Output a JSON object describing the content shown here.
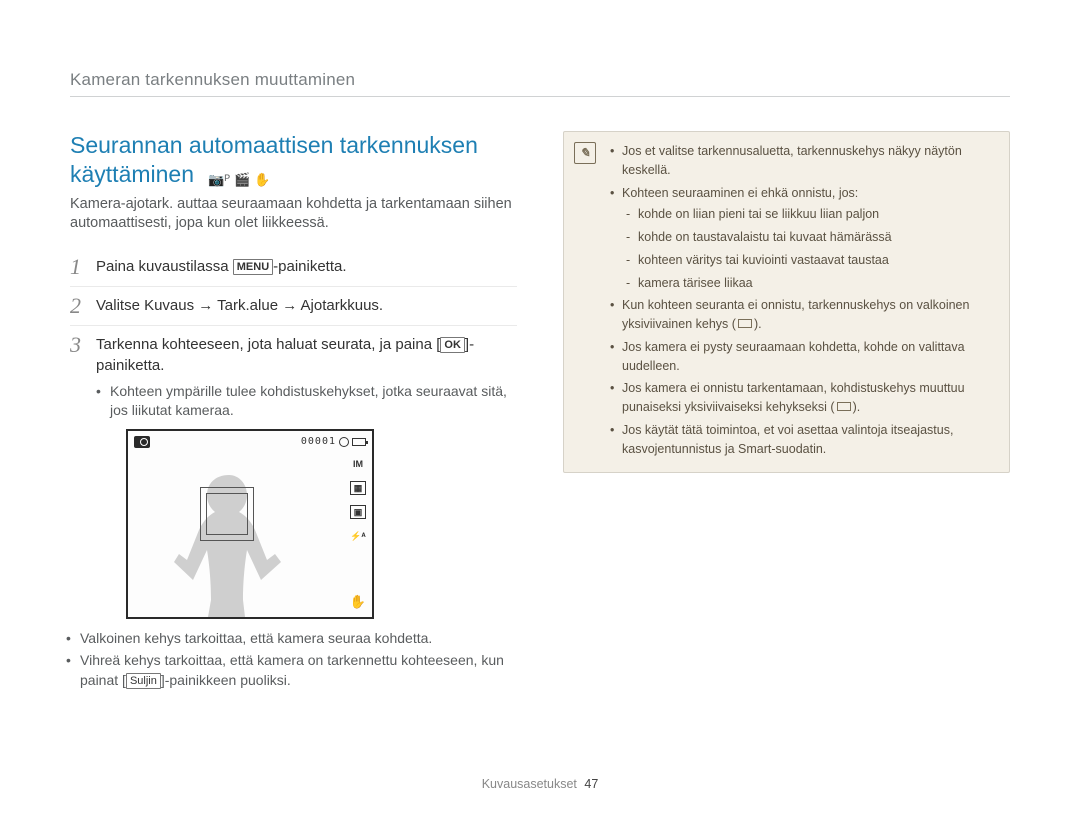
{
  "header": {
    "breadcrumb": "Kameran tarkennuksen muuttaminen"
  },
  "section": {
    "title_line1": "Seurannan automaattisen tarkennuksen",
    "title_line2": "käyttäminen",
    "mode_icons": [
      "📷ᴾ",
      "🎬",
      "✋"
    ],
    "intro": "Kamera-ajotark. auttaa seuraamaan kohdetta ja tarkentamaan siihen automaattisesti, jopa kun olet liikkeessä."
  },
  "steps": [
    {
      "num": "1",
      "pre": "Paina kuvaustilassa ",
      "button": "MENU",
      "post": "-painiketta."
    },
    {
      "num": "2",
      "pre": "Valitse ",
      "path": "Kuvaus → Tark.alue → Ajotarkkuus",
      "post": "."
    },
    {
      "num": "3",
      "pre": "Tarkenna kohteeseen, jota haluat seurata, ja paina [",
      "button": "OK",
      "post": "]-painiketta."
    }
  ],
  "step3_sub": "Kohteen ympärille tulee kohdistuskehykset, jotka seuraavat sitä, jos liikutat kameraa.",
  "lcd": {
    "counter": "00001",
    "side": [
      "IM",
      "▦",
      "▣",
      "⚡ᴬ"
    ],
    "hand": "✋"
  },
  "after_lcd": [
    "Valkoinen kehys tarkoittaa, että kamera seuraa kohdetta.",
    {
      "pre": "Vihreä kehys tarkoittaa, että kamera on tarkennettu kohteeseen, kun painat [",
      "btn": "Suljin",
      "post": "]-painikkeen puoliksi."
    }
  ],
  "notebox": {
    "items": [
      {
        "t": "Jos et valitse tarkennusaluetta, tarkennuskehys näkyy näytön keskellä."
      },
      {
        "t": "Kohteen seuraaminen ei ehkä onnistu, jos:",
        "sub": [
          "kohde on liian pieni tai se liikkuu liian paljon",
          "kohde on taustavalaistu tai kuvaat hämärässä",
          "kohteen väritys tai kuviointi vastaavat taustaa",
          "kamera tärisee liikaa"
        ]
      },
      {
        "t_pre": "Kun kohteen seuranta ei onnistu, tarkennuskehys on valkoinen yksiviivainen kehys (",
        "rect": true,
        "t_post": ")."
      },
      {
        "t": "Jos kamera ei pysty seuraamaan kohdetta, kohde on valittava uudelleen."
      },
      {
        "t_pre": "Jos kamera ei onnistu tarkentamaan, kohdistuskehys muuttuu punaiseksi yksiviivaiseksi kehykseksi (",
        "rect": true,
        "t_post": ")."
      },
      {
        "t": "Jos käytät tätä toimintoa, et voi asettaa valintoja itseajastus, kasvojentunnistus ja Smart-suodatin."
      }
    ]
  },
  "footer": {
    "label": "Kuvausasetukset",
    "page": "47"
  }
}
